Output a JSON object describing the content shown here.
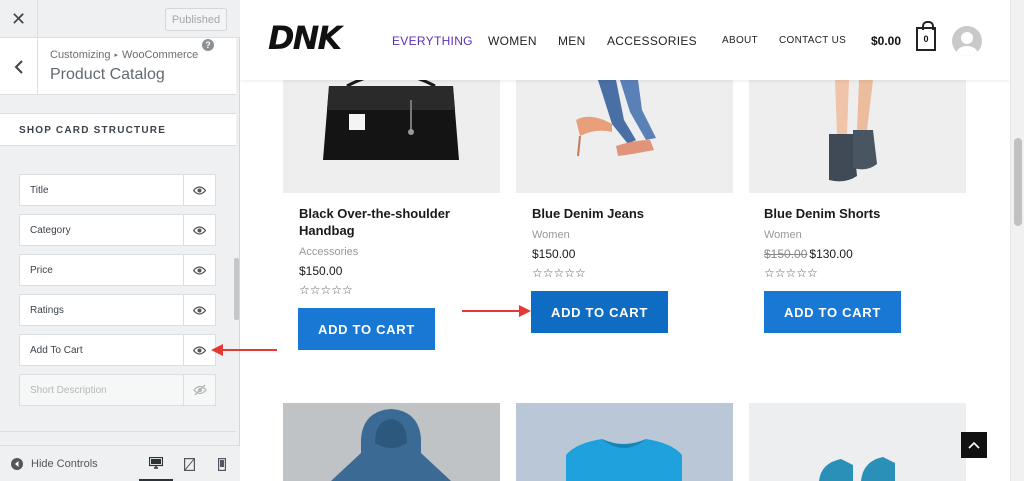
{
  "customizer": {
    "close_label": "✕",
    "published_label": "Published",
    "breadcrumb": {
      "root": "Customizing",
      "separator": "▸",
      "parent": "WooCommerce"
    },
    "section_title": "Product Catalog",
    "help_label": "?",
    "group_title": "SHOP CARD STRUCTURE",
    "items": [
      {
        "label": "Title",
        "visible": true
      },
      {
        "label": "Category",
        "visible": true
      },
      {
        "label": "Price",
        "visible": true
      },
      {
        "label": "Ratings",
        "visible": true
      },
      {
        "label": "Add To Cart",
        "visible": true
      },
      {
        "label": "Short Description",
        "visible": false
      }
    ],
    "hide_controls_label": "Hide Controls",
    "devices": [
      "desktop-icon",
      "tablet-icon",
      "mobile-icon"
    ],
    "active_device": "desktop"
  },
  "site": {
    "logo": "DNK",
    "nav": [
      "EVERYTHING",
      "WOMEN",
      "MEN",
      "ACCESSORIES"
    ],
    "nav_active": "EVERYTHING",
    "nav_secondary": [
      "ABOUT",
      "CONTACT US"
    ],
    "cart_total": "$0.00",
    "cart_count": "0",
    "accent_color": "#5b2fb5",
    "button_color": "#1878d3"
  },
  "products": [
    {
      "title": "Black Over-the-shoulder Handbag",
      "category": "Accessories",
      "old_price": "",
      "price": "$150.00",
      "rating": "☆☆☆☆☆",
      "button": "ADD TO CART"
    },
    {
      "title": "Blue Denim Jeans",
      "category": "Women",
      "old_price": "",
      "price": "$150.00",
      "rating": "☆☆☆☆☆",
      "button": "ADD TO CART"
    },
    {
      "title": "Blue Denim Shorts",
      "category": "Women",
      "old_price": "$150.00",
      "price": "$130.00",
      "rating": "☆☆☆☆☆",
      "button": "ADD TO CART"
    }
  ]
}
